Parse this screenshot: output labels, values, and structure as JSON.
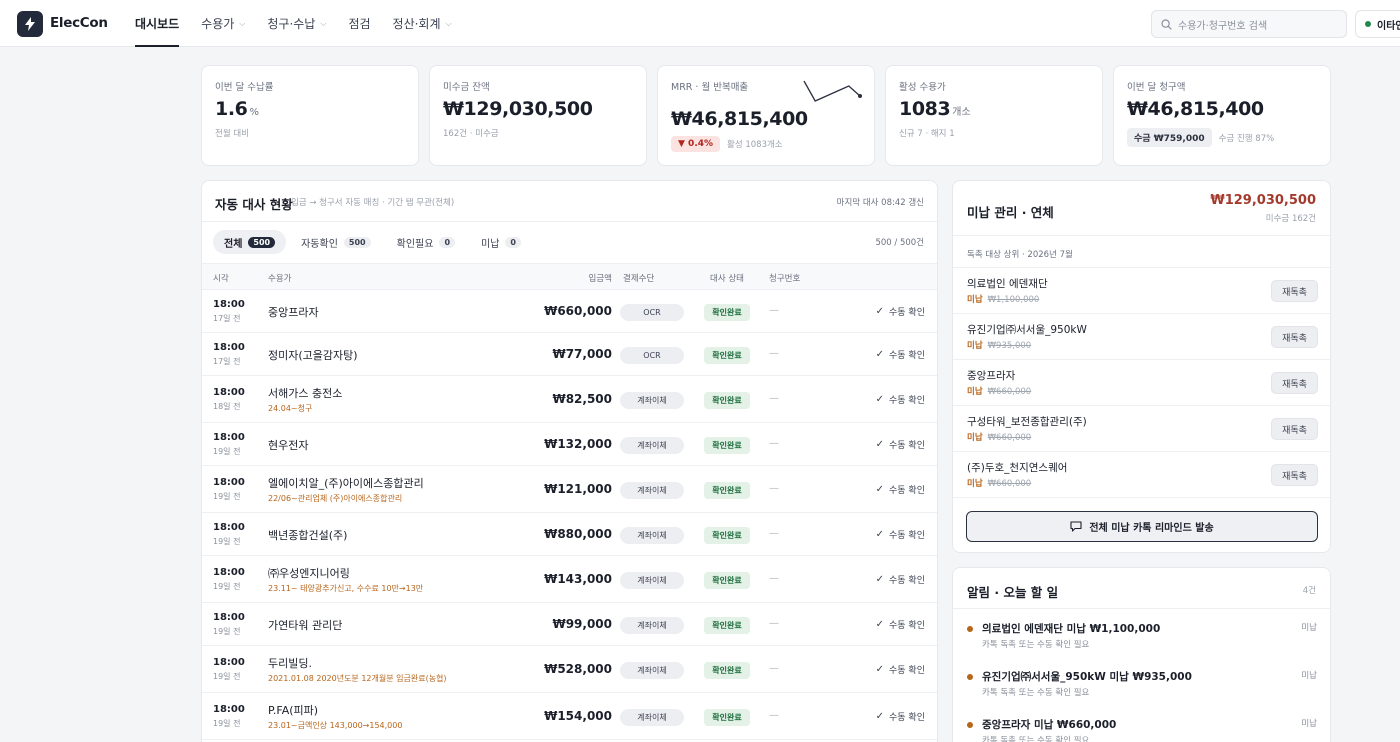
{
  "header": {
    "brand": "ElecCon",
    "nav": [
      {
        "label": "대시보드",
        "active": true,
        "dropdown": false
      },
      {
        "label": "수용가",
        "active": false,
        "dropdown": true
      },
      {
        "label": "청구·수납",
        "active": false,
        "dropdown": true
      },
      {
        "label": "점검",
        "active": false,
        "dropdown": false
      },
      {
        "label": "정산·회계",
        "active": false,
        "dropdown": true
      }
    ],
    "search_placeholder": "수용가·청구번호 검색",
    "user_label": "이타인"
  },
  "kpis": {
    "collection_rate": {
      "label": "이번 달 수납률",
      "value": "1.6",
      "unit": "%",
      "sub": "전월 대비"
    },
    "unpaid_balance": {
      "label": "미수금 잔액",
      "value": "₩129,030,500",
      "sub": "162건 · 미수금"
    },
    "mrr": {
      "label": "MRR · 월 반복매출",
      "value": "₩46,815,400",
      "badge": "▼ 0.4%",
      "sub": "활성 1083개소",
      "sparkline": [
        30,
        22,
        24,
        26,
        28,
        24
      ]
    },
    "active_customers": {
      "label": "활성 수용가",
      "value": "1083",
      "unit": "개소",
      "sub": "신규 7 · 해지 1"
    },
    "billed": {
      "label": "이번 달 청구액",
      "value": "₩46,815,400",
      "badge": "수금 ₩759,000",
      "sub": "수금 진행 87%"
    }
  },
  "recon": {
    "title": "자동 대사 현황",
    "subtitle": "입금 → 청구서 자동 매칭 · 기간 탭 무관(전체)",
    "last_sync": "마지막 대사 08:42 갱신",
    "tabs": [
      {
        "label": "전체",
        "count": "500",
        "active": true
      },
      {
        "label": "자동확인",
        "count": "500",
        "active": false
      },
      {
        "label": "확인필요",
        "count": "0",
        "active": false
      },
      {
        "label": "미납",
        "count": "0",
        "active": false
      }
    ],
    "page_count": "500 / 500건",
    "columns": {
      "time": "시각",
      "customer": "수용가",
      "amount": "입금액",
      "method": "결제수단",
      "status": "대사 상태",
      "invoice": "청구번호"
    },
    "manual_label": "수동 확인",
    "rows": [
      {
        "time": "18:00",
        "ago": "17일 전",
        "name": "중앙프라자",
        "note": "",
        "amount": "₩660,000",
        "method": "OCR",
        "status": "확인완료",
        "invoice": "—"
      },
      {
        "time": "18:00",
        "ago": "17일 전",
        "name": "정미자(고을감자탕)",
        "note": "",
        "amount": "₩77,000",
        "method": "OCR",
        "status": "확인완료",
        "invoice": "—"
      },
      {
        "time": "18:00",
        "ago": "18일 전",
        "name": "서해가스 충전소",
        "note": "24.04~청구",
        "amount": "₩82,500",
        "method": "계좌이체",
        "status": "확인완료",
        "invoice": "—"
      },
      {
        "time": "18:00",
        "ago": "19일 전",
        "name": "현우전자",
        "note": "",
        "amount": "₩132,000",
        "method": "계좌이체",
        "status": "확인완료",
        "invoice": "—"
      },
      {
        "time": "18:00",
        "ago": "19일 전",
        "name": "엘에이치알_(주)아이에스종합관리",
        "note": "22/06~관리업체 (주)아이에스종합관리",
        "amount": "₩121,000",
        "method": "계좌이체",
        "status": "확인완료",
        "invoice": "—"
      },
      {
        "time": "18:00",
        "ago": "19일 전",
        "name": "백년종합건설(주)",
        "note": "",
        "amount": "₩880,000",
        "method": "계좌이체",
        "status": "확인완료",
        "invoice": "—"
      },
      {
        "time": "18:00",
        "ago": "19일 전",
        "name": "㈜우성엔지니어링",
        "note": "23.11~ 태양광추가신고, 수수료 10만→13만",
        "amount": "₩143,000",
        "method": "계좌이체",
        "status": "확인완료",
        "invoice": "—"
      },
      {
        "time": "18:00",
        "ago": "19일 전",
        "name": "가연타워 관리단",
        "note": "",
        "amount": "₩99,000",
        "method": "계좌이체",
        "status": "확인완료",
        "invoice": "—"
      },
      {
        "time": "18:00",
        "ago": "19일 전",
        "name": "두리빌딩.",
        "note": "2021.01.08 2020년도분 12개월분 입금완료(농협)",
        "amount": "₩528,000",
        "method": "계좌이체",
        "status": "확인완료",
        "invoice": "—"
      },
      {
        "time": "18:00",
        "ago": "19일 전",
        "name": "P.FA(피파)",
        "note": "23.01~금액인상 143,000→154,000",
        "amount": "₩154,000",
        "method": "계좌이체",
        "status": "확인완료",
        "invoice": "—"
      }
    ]
  },
  "overdue": {
    "title": "미납 관리 · 연체",
    "total": "₩129,030,500",
    "total_sub": "미수금 162건",
    "section_label": "독촉 대상 상위 · 2026년 7월",
    "items": [
      {
        "name": "의료법인 에덴재단",
        "state": "미납",
        "amount": "₩1,100,000",
        "action": "재독촉"
      },
      {
        "name": "유진기업㈜서서울_950kW",
        "state": "미납",
        "amount": "₩935,000",
        "action": "재독촉"
      },
      {
        "name": "중앙프라자",
        "state": "미납",
        "amount": "₩660,000",
        "action": "재독촉"
      },
      {
        "name": "구성타워_보전종합관리(주)",
        "state": "미납",
        "amount": "₩660,000",
        "action": "재독촉"
      },
      {
        "name": "(주)두호_천지연스퀘어",
        "state": "미납",
        "amount": "₩660,000",
        "action": "재독촉"
      }
    ],
    "bulk_button": "전체 미납 카톡 리마인드 발송"
  },
  "alerts": {
    "title": "알림 · 오늘 할 일",
    "count": "4건",
    "items": [
      {
        "title": "의료법인 에덴재단 미납 ₩1,100,000",
        "sub": "카톡 독촉 또는 수동 확인 필요",
        "tag": "미납"
      },
      {
        "title": "유진기업㈜서서울_950kW 미납 ₩935,000",
        "sub": "카톡 독촉 또는 수동 확인 필요",
        "tag": "미납"
      },
      {
        "title": "중앙프라자 미납 ₩660,000",
        "sub": "카톡 독촉 또는 수동 확인 필요",
        "tag": "미납"
      }
    ]
  },
  "colors": {
    "accent": "#232a3b",
    "overdue": "#b8651c",
    "total_red": "#a33a2c",
    "ok_green": "#1f6e3e"
  }
}
